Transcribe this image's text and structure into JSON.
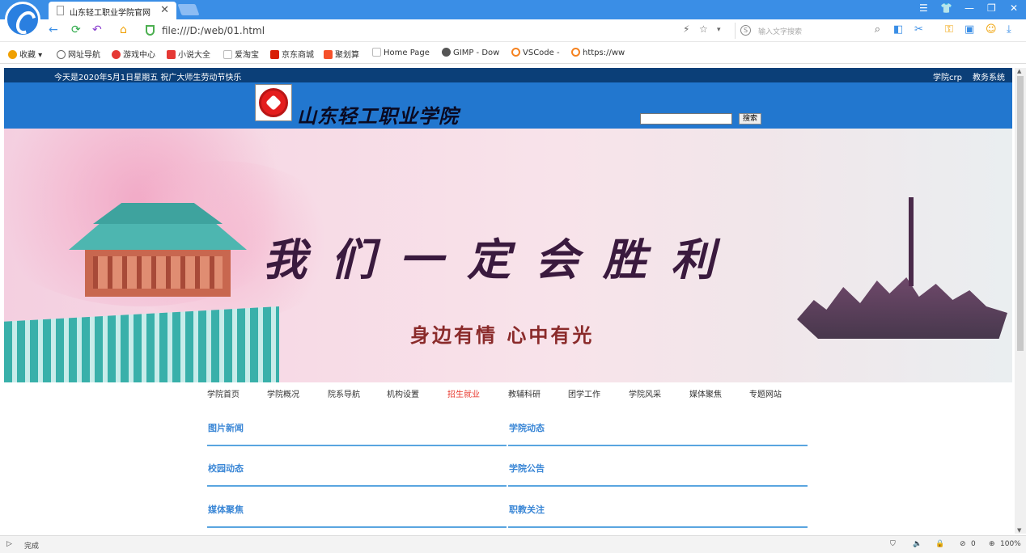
{
  "browser": {
    "tab_title": "山东轻工职业学院官网",
    "tab_close": "✕",
    "menu_icon": "☰",
    "skin_icon": "👕",
    "minimize": "—",
    "restore": "❐",
    "close": "✕",
    "address": "file:///D:/web/01.html",
    "search_placeholder": "输入文字搜索",
    "bookmarks": [
      {
        "label": "收藏",
        "icon": "star-icon",
        "color": "#f0a000"
      },
      {
        "label": "网址导航",
        "icon": "globe-icon",
        "color": "#666666"
      },
      {
        "label": "游戏中心",
        "icon": "game-icon",
        "color": "#e53935"
      },
      {
        "label": "小说大全",
        "icon": "book-icon",
        "color": "#e53935"
      },
      {
        "label": "爱淘宝",
        "icon": "page-icon",
        "color": "#cccccc"
      },
      {
        "label": "京东商城",
        "icon": "jd-icon",
        "color": "#d81e06"
      },
      {
        "label": "聚划算",
        "icon": "juhuasuan-icon",
        "color": "#f5502a"
      },
      {
        "label": "Home Page",
        "icon": "page-icon",
        "color": "#cccccc"
      },
      {
        "label": "GIMP - Dow",
        "icon": "gimp-icon",
        "color": "#555555"
      },
      {
        "label": "VSCode -",
        "icon": "sogou-icon",
        "color": "#f58220"
      },
      {
        "label": "https://ww",
        "icon": "sogou-icon",
        "color": "#f58220"
      }
    ],
    "status_left": "完成",
    "status_count": "0",
    "zoom": "100%"
  },
  "site": {
    "top_notice": "今天是2020年5月1日星期五  祝广大师生劳动节快乐",
    "top_links": [
      "学院crp",
      "教务系统"
    ],
    "school_name": "山东轻工职业学院",
    "search_button": "搜索",
    "banner_slogan": "我们一定会胜利",
    "banner_subtitle": "身边有情  心中有光",
    "nav": [
      {
        "label": "学院首页",
        "active": false
      },
      {
        "label": "学院概况",
        "active": false
      },
      {
        "label": "院系导航",
        "active": false
      },
      {
        "label": "机构设置",
        "active": false
      },
      {
        "label": "招生就业",
        "active": true
      },
      {
        "label": "教辅科研",
        "active": false
      },
      {
        "label": "团学工作",
        "active": false
      },
      {
        "label": "学院风采",
        "active": false
      },
      {
        "label": "媒体聚焦",
        "active": false
      },
      {
        "label": "专题网站",
        "active": false
      }
    ],
    "sections": [
      "图片新闻",
      "学院动态",
      "校园动态",
      "学院公告",
      "媒体聚焦",
      "职教关注"
    ],
    "colors": {
      "header_blue": "#2277cf",
      "dark_strip": "#0b3f78",
      "section_blue": "#3b87d6",
      "active_red": "#e8372c"
    }
  }
}
